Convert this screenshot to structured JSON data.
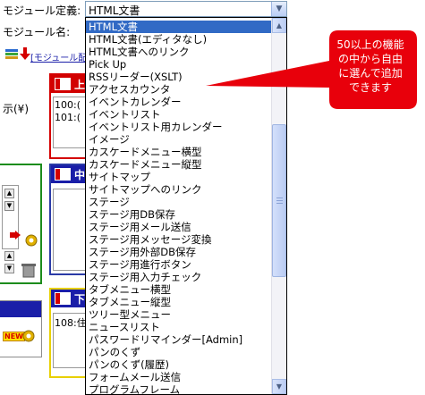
{
  "form": {
    "module_def_label": "モジュール定義:",
    "module_name_label": "モジュール名:",
    "module_link_text": "[モジュール配",
    "selected_value": "HTML文書",
    "left_char": "示(¥)"
  },
  "panels": {
    "red_header_char": "上",
    "red_lines": [
      "100:(",
      "101:("
    ],
    "blue_header_char": "中",
    "yellow_header_char": "下",
    "yellow_line": "108:住",
    "new_badge": "NEW"
  },
  "dropdown": {
    "options": [
      "HTML文書",
      "HTML文書(エディタなし)",
      "HTML文書へのリンク",
      "Pick Up",
      "RSSリーダー(XSLT)",
      "アクセスカウンタ",
      "イベントカレンダー",
      "イベントリスト",
      "イベントリスト用カレンダー",
      "イメージ",
      "カスケードメニュー横型",
      "カスケードメニュー縦型",
      "サイトマップ",
      "サイトマップへのリンク",
      "ステージ",
      "ステージ用DB保存",
      "ステージ用メール送信",
      "ステージ用メッセージ変換",
      "ステージ用外部DB保存",
      "ステージ用進行ボタン",
      "ステージ用入力チェック",
      "タブメニュー横型",
      "タブメニュー縦型",
      "ツリー型メニュー",
      "ニュースリスト",
      "パスワードリマインダー[Admin]",
      "パンのくず",
      "パンのくず(履歴)",
      "フォームメール送信",
      "プログラムフレーム"
    ],
    "selected_index": 0
  },
  "callout": {
    "text": "50以上の機能の中から自由に選んで追加できます",
    "color": "#e8000b"
  },
  "colors": {
    "selection": "#316ac5",
    "red_panel": "#d40000",
    "blue_panel": "#1a1ea8",
    "green_panel": "#1c8c1c",
    "yellow_panel": "#e8d000"
  }
}
